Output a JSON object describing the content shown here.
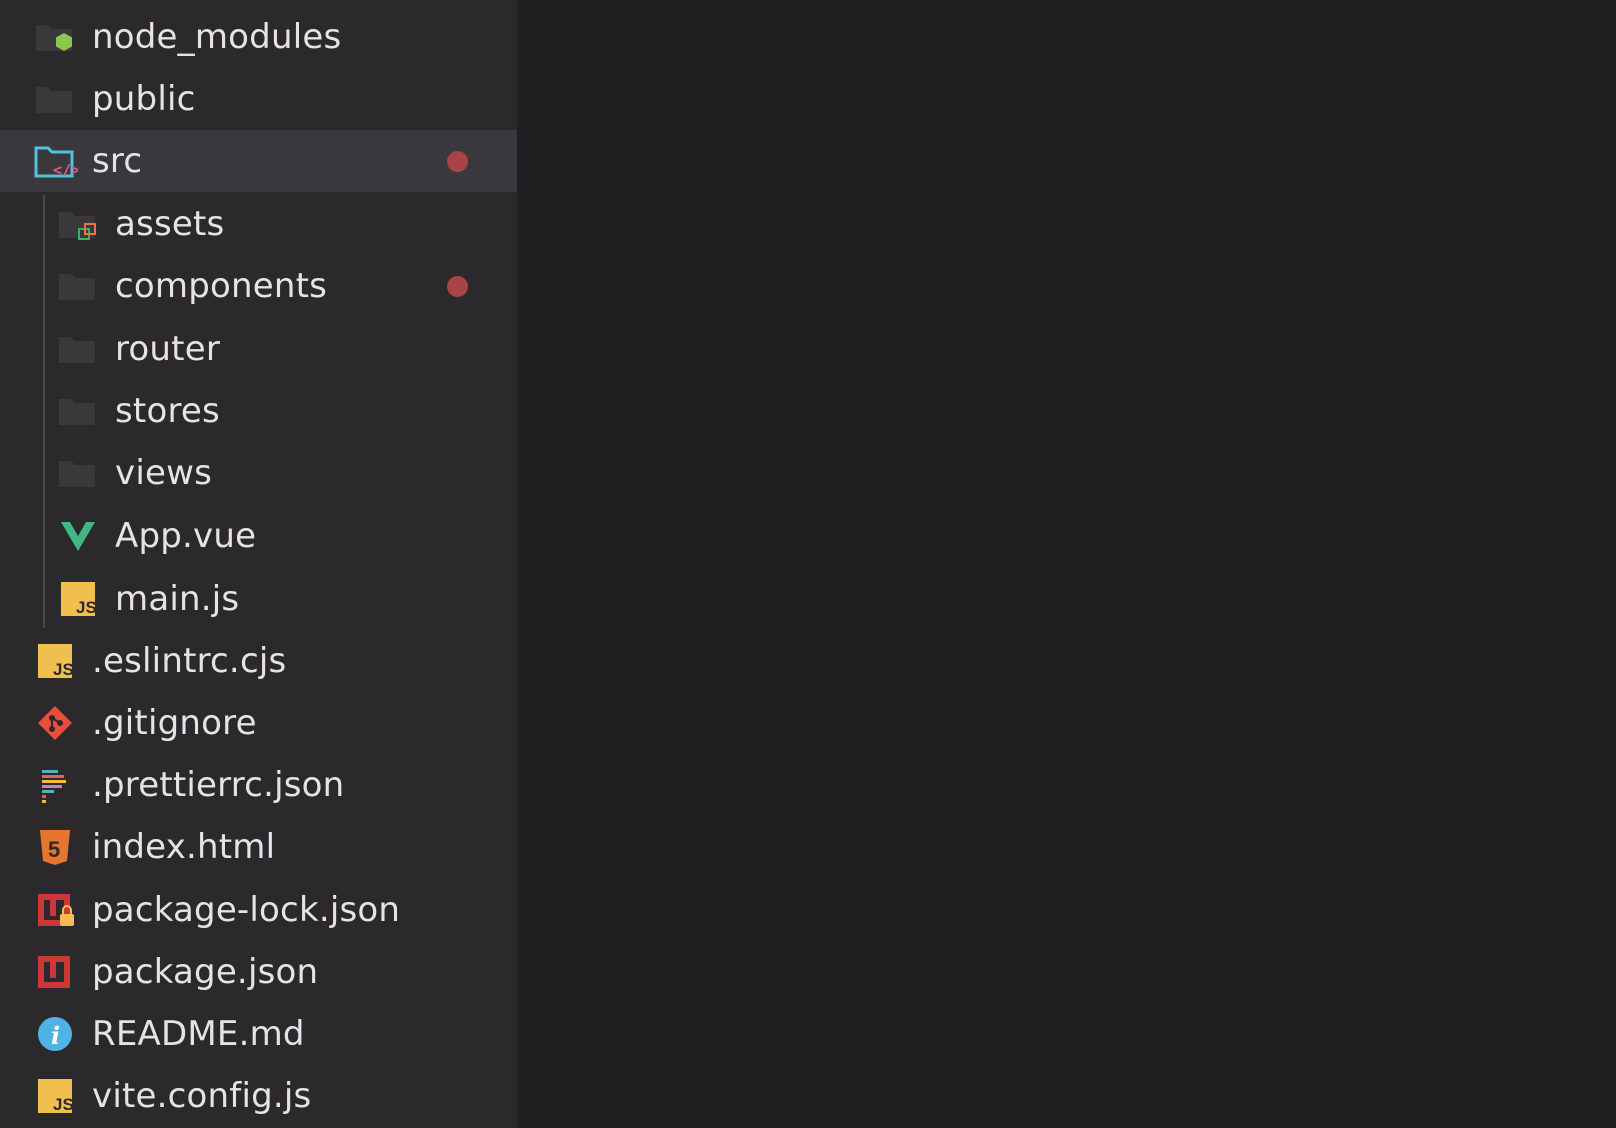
{
  "explorer": {
    "items": [
      {
        "label": "node_modules",
        "icon": "node-folder-icon"
      },
      {
        "label": "public",
        "icon": "folder-icon"
      },
      {
        "label": "src",
        "icon": "src-folder-open-icon",
        "modified": true
      },
      {
        "label": "assets",
        "icon": "assets-folder-icon"
      },
      {
        "label": "components",
        "icon": "folder-icon",
        "modified": true
      },
      {
        "label": "router",
        "icon": "folder-icon"
      },
      {
        "label": "stores",
        "icon": "folder-icon"
      },
      {
        "label": "views",
        "icon": "folder-icon"
      },
      {
        "label": "App.vue",
        "icon": "vue-icon"
      },
      {
        "label": "main.js",
        "icon": "js-icon",
        "badge": "JS"
      },
      {
        "label": ".eslintrc.cjs",
        "icon": "js-icon",
        "badge": "JS"
      },
      {
        "label": ".gitignore",
        "icon": "git-icon"
      },
      {
        "label": ".prettierrc.json",
        "icon": "prettier-icon"
      },
      {
        "label": "index.html",
        "icon": "html5-icon",
        "badge": "5"
      },
      {
        "label": "package-lock.json",
        "icon": "npm-lock-icon"
      },
      {
        "label": "package.json",
        "icon": "npm-icon"
      },
      {
        "label": "README.md",
        "icon": "info-icon",
        "badge": "i"
      },
      {
        "label": "vite.config.js",
        "icon": "js-icon",
        "badge": "JS"
      }
    ]
  },
  "colors": {
    "sidebar_bg": "#2b292c",
    "editor_bg": "#221f22",
    "selected_row": "#3b383d",
    "text": "#e6e3e6",
    "modified_dot": "#a84448",
    "node_green": "#8cc84b",
    "vue_green": "#41b883",
    "js_yellow": "#f1bf4d",
    "git_red": "#e84d3d",
    "html_orange": "#e6762e",
    "npm_red": "#cb3837",
    "info_blue": "#4fb3e8"
  }
}
